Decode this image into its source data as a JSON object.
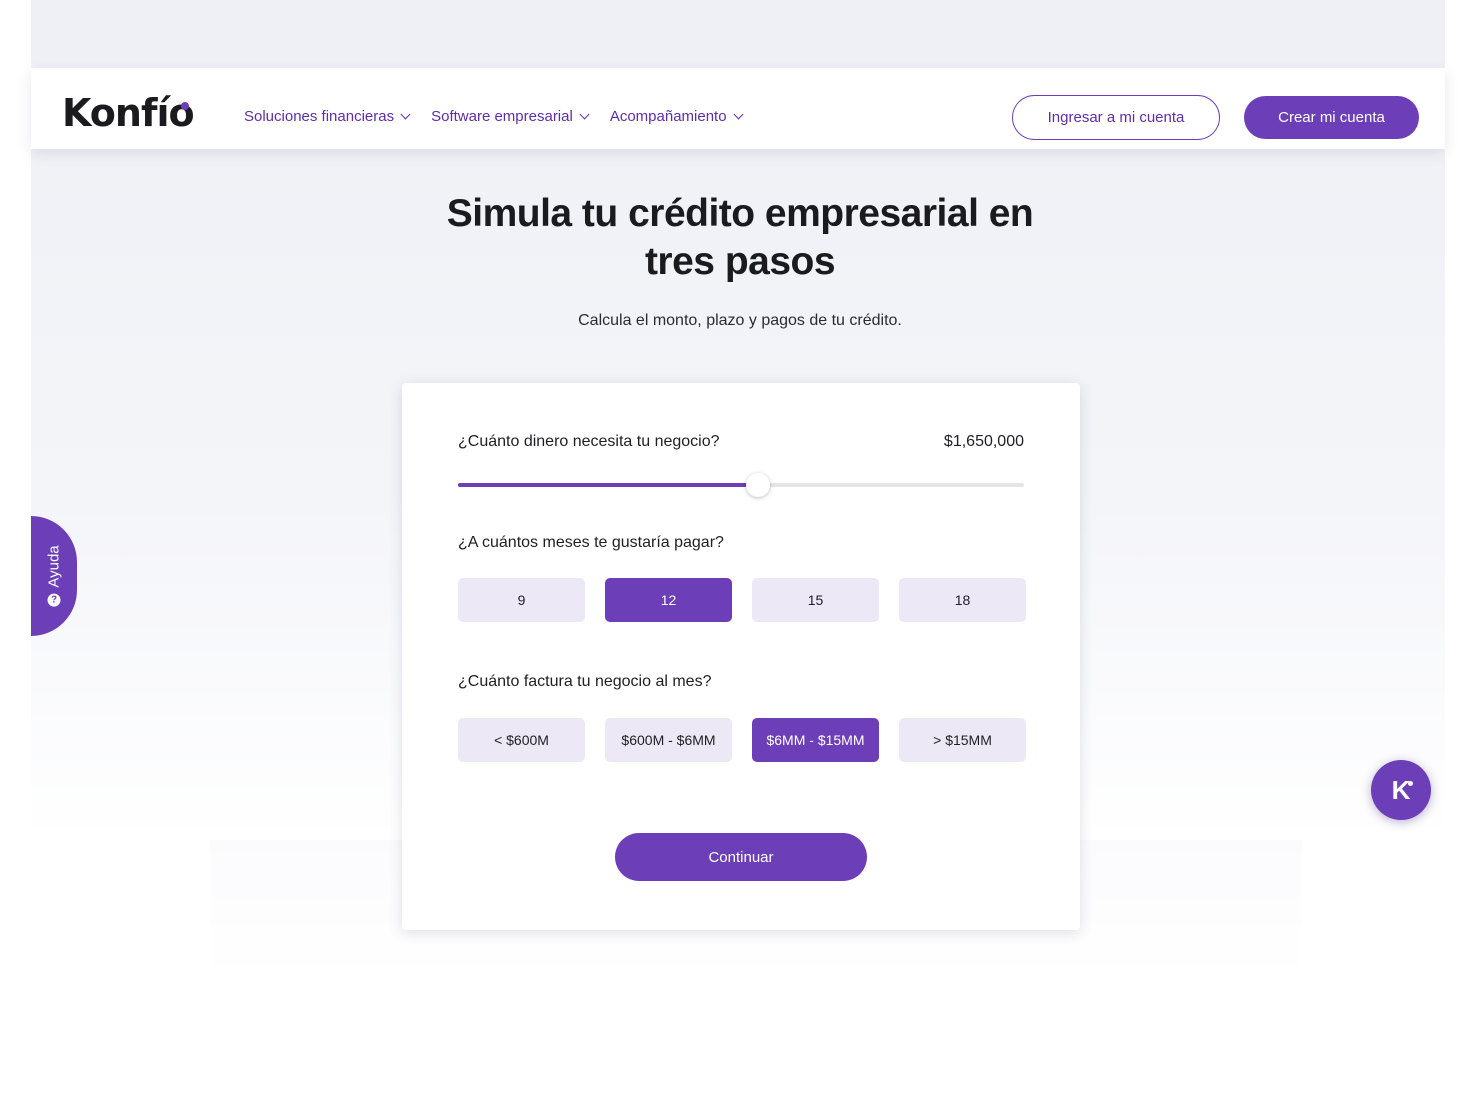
{
  "header": {
    "logo_text": "Konfío",
    "nav": [
      {
        "label": "Soluciones financieras"
      },
      {
        "label": "Software empresarial"
      },
      {
        "label": "Acompañamiento"
      }
    ],
    "login_label": "Ingresar a mi cuenta",
    "signup_label": "Crear mi cuenta"
  },
  "hero": {
    "title": "Simula tu crédito empresarial en tres pasos",
    "subtitle": "Calcula el monto, plazo y pagos de tu crédito."
  },
  "form": {
    "amount_question": "¿Cuánto dinero necesita tu negocio?",
    "amount_value": "$1,650,000",
    "amount_slider_fraction": 0.53,
    "months_question": "¿A cuántos meses te gustaría pagar?",
    "months_options": [
      "9",
      "12",
      "15",
      "18"
    ],
    "months_selected": "12",
    "revenue_question": "¿Cuánto factura tu negocio al mes?",
    "revenue_options": [
      "< $600M",
      "$600M - $6MM",
      "$6MM - $15MM",
      "> $15MM"
    ],
    "revenue_selected": "$6MM - $15MM",
    "continue_label": "Continuar"
  },
  "help": {
    "label": "Ayuda",
    "icon": "question-icon"
  },
  "chat": {
    "label": "K",
    "icon": "konfio-k-icon"
  },
  "colors": {
    "brand": "#6c3eb8",
    "option_bg": "#ece8f6"
  }
}
